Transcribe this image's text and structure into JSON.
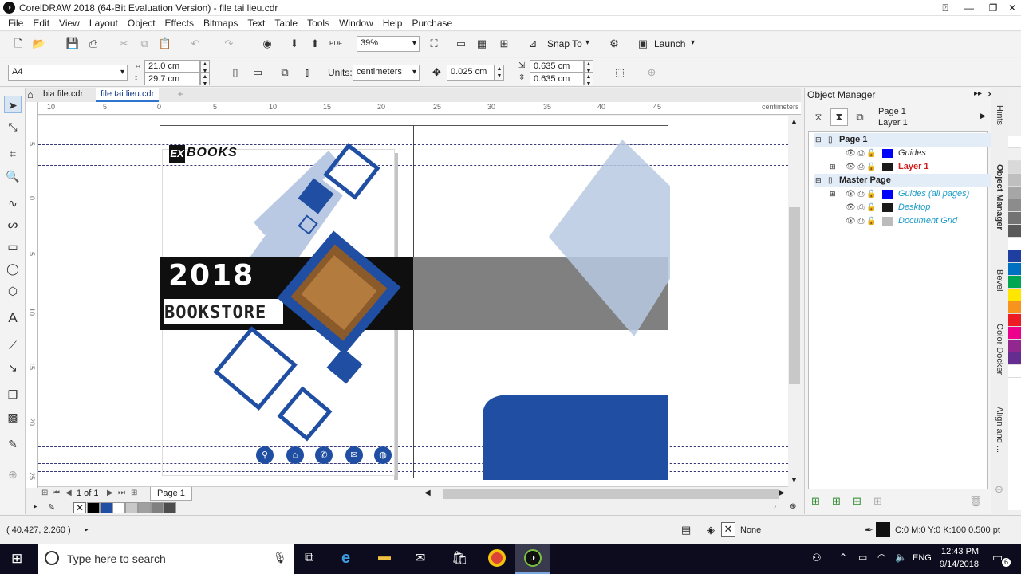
{
  "window": {
    "title": "CorelDRAW 2018 (64-Bit Evaluation Version) - file tai lieu.cdr"
  },
  "menu": [
    "File",
    "Edit",
    "View",
    "Layout",
    "Object",
    "Effects",
    "Bitmaps",
    "Text",
    "Table",
    "Tools",
    "Window",
    "Help",
    "Purchase"
  ],
  "toolbar1": {
    "zoom": "39%",
    "snap_to": "Snap To",
    "launch": "Launch"
  },
  "toolbar2": {
    "page_size": "A4",
    "width": "21.0 cm",
    "height": "29.7 cm",
    "units_label": "Units:",
    "units": "centimeters",
    "nudge": "0.025 cm",
    "dup_x": "0.635 cm",
    "dup_y": "0.635 cm"
  },
  "tabs": [
    "bia file.cdr",
    "file tai lieu.cdr"
  ],
  "ruler": {
    "unit": "centimeters",
    "h_ticks": [
      "10",
      "5",
      "0",
      "5",
      "10",
      "15",
      "20",
      "25",
      "30",
      "35",
      "40",
      "45"
    ],
    "v_ticks": [
      "5",
      "0",
      "5",
      "10",
      "15",
      "20",
      "25"
    ]
  },
  "design": {
    "logo": "BOOKS",
    "year": "2018",
    "store": "BOOKSTORE"
  },
  "pagenav": {
    "page_count": "1 of 1",
    "page_tab": "Page 1"
  },
  "docker": {
    "title": "Object Manager",
    "page_label": "Page 1",
    "layer_label": "Layer 1",
    "tree": [
      {
        "label": "Page 1",
        "level": 0,
        "color": "",
        "style": "bold"
      },
      {
        "label": "Guides",
        "level": 1,
        "color": "#0000ff",
        "style": "guides"
      },
      {
        "label": "Layer 1",
        "level": 1,
        "color": "#1a1a1a",
        "style": "active"
      },
      {
        "label": "Master Page",
        "level": 0,
        "color": "",
        "style": "bold"
      },
      {
        "label": "Guides (all pages)",
        "level": 1,
        "color": "#0000ff",
        "style": "italic"
      },
      {
        "label": "Desktop",
        "level": 1,
        "color": "#1a1a1a",
        "style": "italic"
      },
      {
        "label": "Document Grid",
        "level": 1,
        "color": "#bbbbbb",
        "style": "italic"
      }
    ]
  },
  "docker_tabs": [
    "Hints",
    "Object Manager",
    "Bevel",
    "Color Docker",
    "Align and ..."
  ],
  "status": {
    "coords": "( 40.427, 2.260 )",
    "fill": "None",
    "outline": "C:0 M:0 Y:0 K:100  0.500 pt"
  },
  "taskbar": {
    "search": "Type here to search",
    "lang": "ENG",
    "time": "12:43 PM",
    "date": "9/14/2018",
    "notif": "6"
  },
  "palette": [
    "#000000",
    "#1f4ea3",
    "#ffffff",
    "#c8c8c8",
    "#a0a0a0",
    "#808080",
    "#4d4d4d"
  ],
  "colorbar": [
    "#ffffff",
    "#f0f0f0",
    "#d9d9d9",
    "#bfbfbf",
    "#a6a6a6",
    "#8c8c8c",
    "#737373",
    "#595959",
    "#ffffff",
    "#1f3fa0",
    "#0070c0",
    "#00a651",
    "#ffe600",
    "#f7941d",
    "#ed1c24",
    "#ec008c",
    "#92278f",
    "#662d91",
    "#ffffff"
  ]
}
